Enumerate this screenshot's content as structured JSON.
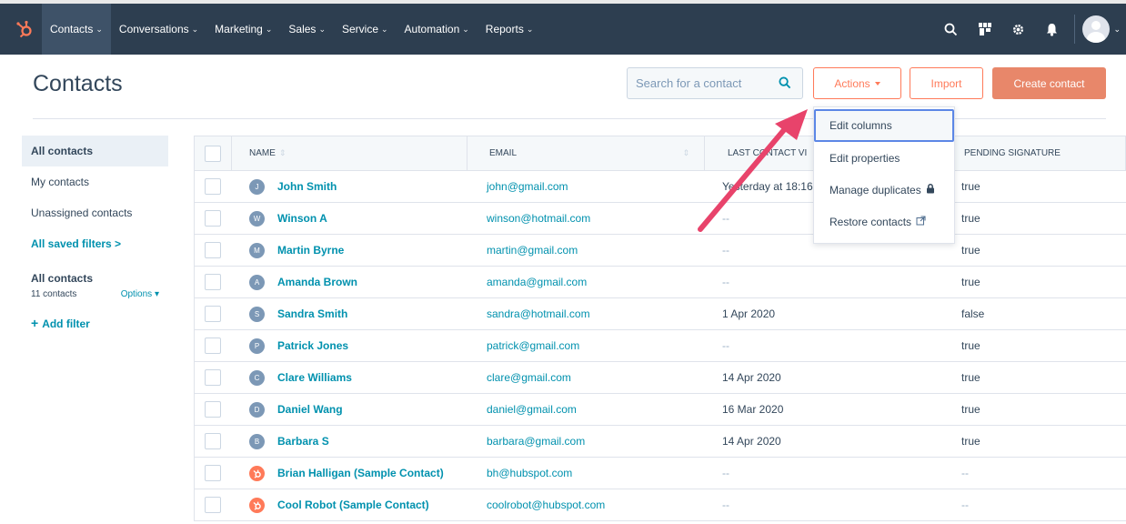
{
  "nav": {
    "items": [
      {
        "label": "Contacts",
        "active": true
      },
      {
        "label": "Conversations",
        "active": false
      },
      {
        "label": "Marketing",
        "active": false
      },
      {
        "label": "Sales",
        "active": false
      },
      {
        "label": "Service",
        "active": false
      },
      {
        "label": "Automation",
        "active": false
      },
      {
        "label": "Reports",
        "active": false
      }
    ],
    "icons": [
      "search-icon",
      "marketplace-icon",
      "settings-icon",
      "notifications-icon"
    ]
  },
  "header": {
    "title": "Contacts",
    "search_placeholder": "Search for a contact",
    "actions_label": "Actions",
    "import_label": "Import",
    "create_label": "Create contact"
  },
  "dropdown": {
    "items": [
      {
        "label": "Edit columns"
      },
      {
        "label": "Edit properties"
      },
      {
        "label": "Manage duplicates"
      },
      {
        "label": "Restore contacts"
      }
    ]
  },
  "sidebar": {
    "items": [
      {
        "label": "All contacts"
      },
      {
        "label": "My contacts"
      },
      {
        "label": "Unassigned contacts"
      }
    ],
    "saved_filters_label": "All saved filters >",
    "group_title": "All contacts",
    "group_count": "11 contacts",
    "group_options": "Options",
    "add_filter_label": "Add filter"
  },
  "table": {
    "columns": {
      "name": "NAME",
      "email": "EMAIL",
      "last_contacted": "LAST CONTACT VI",
      "pending": "PENDING SIGNATURE"
    },
    "rows": [
      {
        "initial": "J",
        "name": "John Smith",
        "email": "john@gmail.com",
        "last": "Yesterday at 18:16",
        "pending": "true",
        "hs": false
      },
      {
        "initial": "W",
        "name": "Winson A",
        "email": "winson@hotmail.com",
        "last": "--",
        "pending": "true",
        "hs": false
      },
      {
        "initial": "M",
        "name": "Martin Byrne",
        "email": "martin@gmail.com",
        "last": "--",
        "pending": "true",
        "hs": false
      },
      {
        "initial": "A",
        "name": "Amanda Brown",
        "email": "amanda@gmail.com",
        "last": "--",
        "pending": "true",
        "hs": false
      },
      {
        "initial": "S",
        "name": "Sandra Smith",
        "email": "sandra@hotmail.com",
        "last": "1 Apr 2020",
        "pending": "false",
        "hs": false
      },
      {
        "initial": "P",
        "name": "Patrick Jones",
        "email": "patrick@gmail.com",
        "last": "--",
        "pending": "true",
        "hs": false
      },
      {
        "initial": "C",
        "name": "Clare Williams",
        "email": "clare@gmail.com",
        "last": "14 Apr 2020",
        "pending": "true",
        "hs": false
      },
      {
        "initial": "D",
        "name": "Daniel Wang",
        "email": "daniel@gmail.com",
        "last": "16 Mar 2020",
        "pending": "true",
        "hs": false
      },
      {
        "initial": "B",
        "name": "Barbara S",
        "email": "barbara@gmail.com",
        "last": "14 Apr 2020",
        "pending": "true",
        "hs": false
      },
      {
        "initial": "",
        "name": "Brian Halligan (Sample Contact)",
        "email": "bh@hubspot.com",
        "last": "--",
        "pending": "--",
        "hs": true
      },
      {
        "initial": "",
        "name": "Cool Robot (Sample Contact)",
        "email": "coolrobot@hubspot.com",
        "last": "--",
        "pending": "--",
        "hs": true
      }
    ]
  },
  "colors": {
    "nav_bg": "#2d3e50",
    "accent": "#ff7a59",
    "link": "#0091ae",
    "highlight_border": "#5c87e6",
    "arrow": "#e8436b"
  }
}
